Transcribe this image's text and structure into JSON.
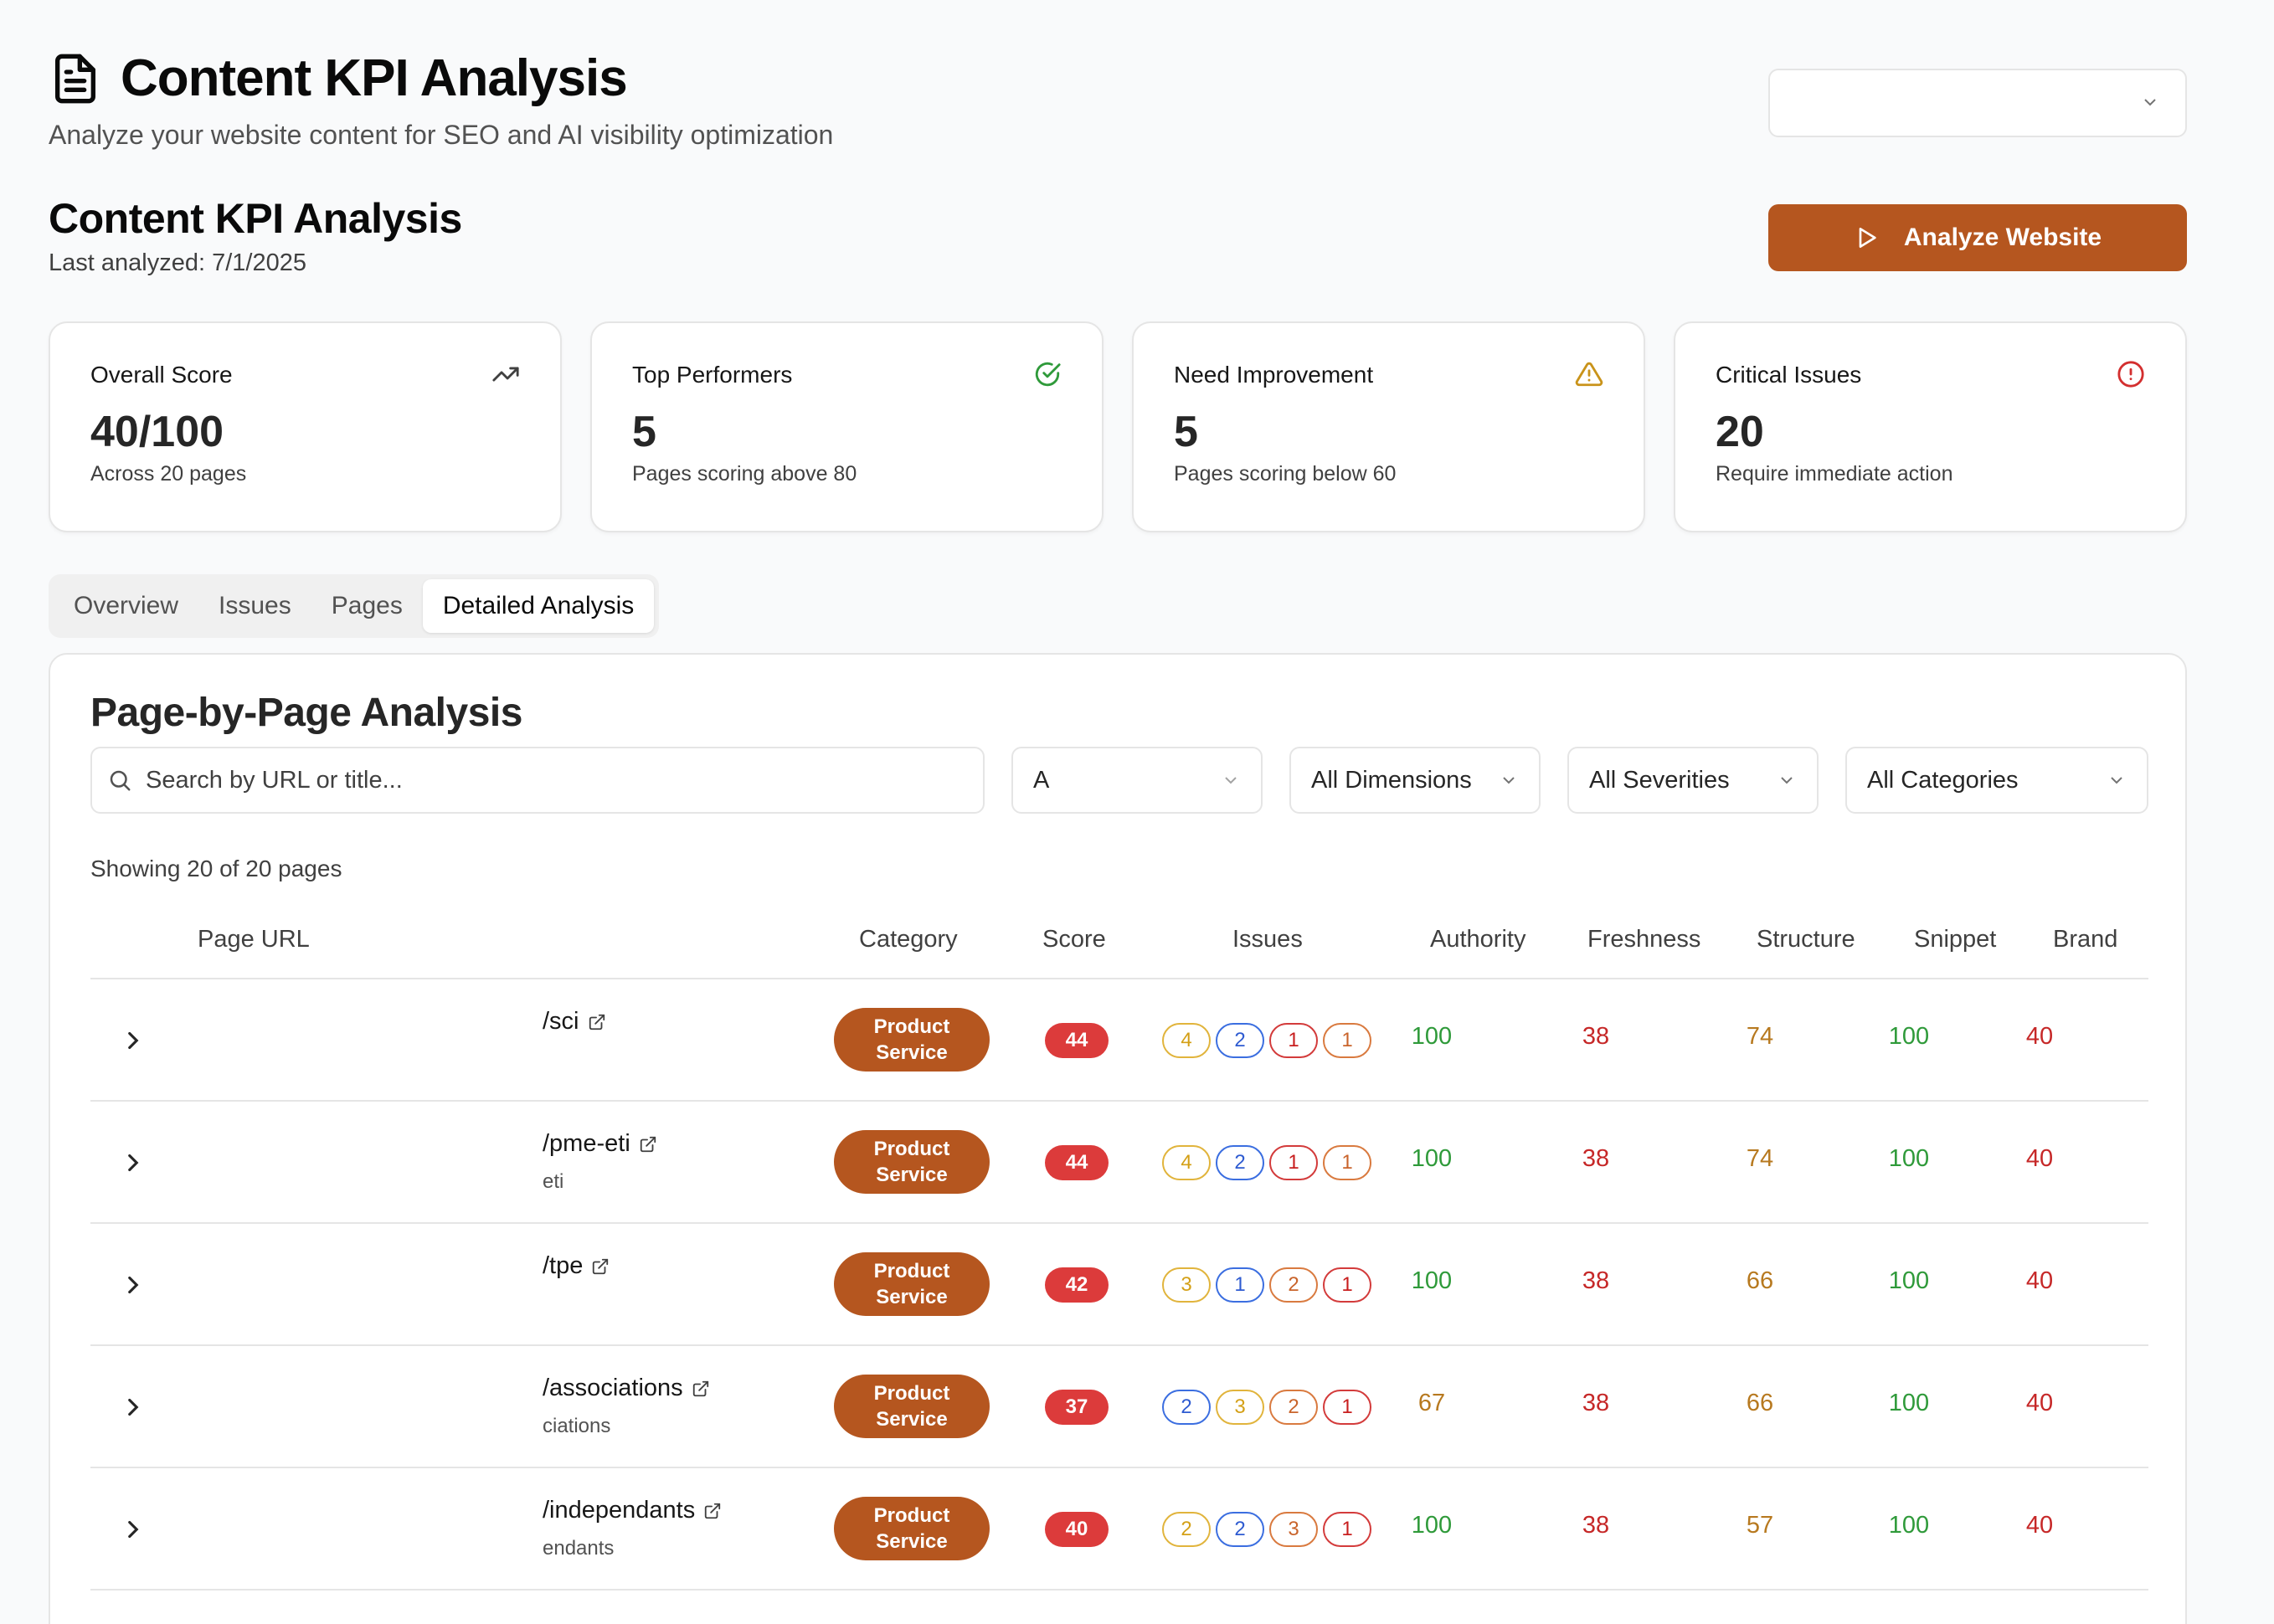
{
  "header": {
    "title": "Content KPI Analysis",
    "subtitle": "Analyze your website content for SEO and AI visibility optimization",
    "select_value": ""
  },
  "section": {
    "title": "Content KPI Analysis",
    "last_analyzed": "Last analyzed: 7/1/2025",
    "analyze_button": "Analyze Website"
  },
  "cards": [
    {
      "label": "Overall Score",
      "value": "40/100",
      "sub": "Across 20 pages",
      "icon": "trending-up-icon"
    },
    {
      "label": "Top Performers",
      "value": "5",
      "sub": "Pages scoring above 80",
      "icon": "check-circle-icon"
    },
    {
      "label": "Need Improvement",
      "value": "5",
      "sub": "Pages scoring below 60",
      "icon": "warning-triangle-icon"
    },
    {
      "label": "Critical Issues",
      "value": "20",
      "sub": "Require immediate action",
      "icon": "alert-circle-icon"
    }
  ],
  "tabs": [
    "Overview",
    "Issues",
    "Pages",
    "Detailed Analysis"
  ],
  "active_tab": "Detailed Analysis",
  "panel": {
    "title": "Page-by-Page Analysis",
    "search_placeholder": "Search by URL or title...",
    "filter_1": "A",
    "filter_dimensions": "All Dimensions",
    "filter_severities": "All Severities",
    "filter_categories": "All Categories",
    "showing": "Showing 20 of 20 pages"
  },
  "table": {
    "headers": [
      "Page URL",
      "Category",
      "Score",
      "Issues",
      "Authority",
      "Freshness",
      "Structure",
      "Snippet",
      "Brand"
    ],
    "rows": [
      {
        "url": "/sci",
        "sub": "",
        "category_line1": "Product",
        "category_line2": "Service",
        "score": "44",
        "issues": [
          {
            "v": "4",
            "c": "y"
          },
          {
            "v": "2",
            "c": "b"
          },
          {
            "v": "1",
            "c": "r"
          },
          {
            "v": "1",
            "c": "o"
          }
        ],
        "authority": "100",
        "freshness": "38",
        "structure": "74",
        "snippet": "100",
        "brand": "40"
      },
      {
        "url": "/pme-eti",
        "sub": "eti",
        "category_line1": "Product",
        "category_line2": "Service",
        "score": "44",
        "issues": [
          {
            "v": "4",
            "c": "y"
          },
          {
            "v": "2",
            "c": "b"
          },
          {
            "v": "1",
            "c": "r"
          },
          {
            "v": "1",
            "c": "o"
          }
        ],
        "authority": "100",
        "freshness": "38",
        "structure": "74",
        "snippet": "100",
        "brand": "40"
      },
      {
        "url": "/tpe",
        "sub": "",
        "category_line1": "Product",
        "category_line2": "Service",
        "score": "42",
        "issues": [
          {
            "v": "3",
            "c": "y"
          },
          {
            "v": "1",
            "c": "b"
          },
          {
            "v": "2",
            "c": "o"
          },
          {
            "v": "1",
            "c": "r"
          }
        ],
        "authority": "100",
        "freshness": "38",
        "structure": "66",
        "snippet": "100",
        "brand": "40"
      },
      {
        "url": "/associations",
        "sub": "ciations",
        "category_line1": "Product",
        "category_line2": "Service",
        "score": "37",
        "issues": [
          {
            "v": "2",
            "c": "b"
          },
          {
            "v": "3",
            "c": "y"
          },
          {
            "v": "2",
            "c": "o"
          },
          {
            "v": "1",
            "c": "r"
          }
        ],
        "authority": "67",
        "freshness": "38",
        "structure": "66",
        "snippet": "100",
        "brand": "40"
      },
      {
        "url": "/independants",
        "sub": "endants",
        "category_line1": "Product",
        "category_line2": "Service",
        "score": "40",
        "issues": [
          {
            "v": "2",
            "c": "y"
          },
          {
            "v": "2",
            "c": "b"
          },
          {
            "v": "3",
            "c": "o"
          },
          {
            "v": "1",
            "c": "r"
          }
        ],
        "authority": "100",
        "freshness": "38",
        "structure": "57",
        "snippet": "100",
        "brand": "40"
      }
    ]
  }
}
